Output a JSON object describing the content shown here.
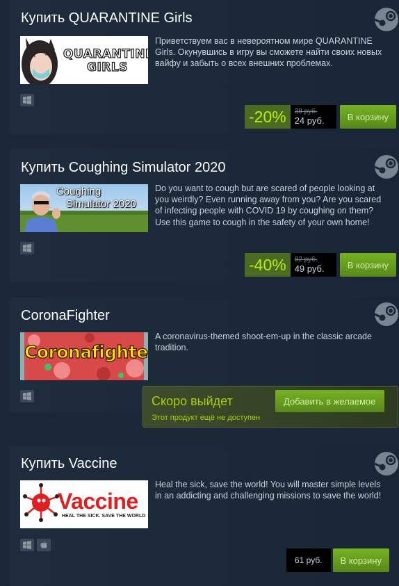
{
  "cards": [
    {
      "title": "Купить QUARANTINE Girls",
      "thumb_text_1": "QUARANTINE",
      "thumb_text_2": "GIRLS",
      "description": "Приветствуем вас в невероятном мире QUARANTINE Girls. Окунувшись в игру вы сможете найти своих новых вайфу и забыть о всех внешних проблемах.",
      "discount": "-20%",
      "old_price": "38 руб.",
      "new_price": "24 руб.",
      "cart_label": "В корзину"
    },
    {
      "title": "Купить Coughing Simulator 2020",
      "thumb_text_1": "Coughing",
      "thumb_text_2": "Simulator 2020",
      "description": "Do you want to cough but are scared of people looking at you weirdly? Even running away from you? Are you scared of infecting people with COVID 19 by coughing on them? Use this game to cough in the safety of your own home!",
      "discount": "-40%",
      "old_price": "82 руб.",
      "new_price": "49 руб.",
      "cart_label": "В корзину"
    },
    {
      "title": "CoronaFighter",
      "thumb_text_1": "Coronafighter",
      "description": "A coronavirus-themed shoot-em-up in the classic arcade tradition.",
      "coming_title": "Скоро выйдет",
      "coming_sub": "Этот продукт ещё не доступен",
      "wishlist_label": "Добавить в желаемое"
    },
    {
      "title": "Купить Vaccine",
      "thumb_text_1": "Vaccine",
      "thumb_text_2": "HEAL THE SICK. SAVE THE WORLD",
      "description": "Heal the sick, save the world! You will master simple levels in an addicting and challenging missions to save the world!",
      "price": "61 руб.",
      "cart_label": "В корзину"
    }
  ],
  "icons": {
    "steam": "steam-logo-icon",
    "windows": "windows-icon",
    "apple": "apple-icon"
  },
  "colors": {
    "background": "#1b2838",
    "discount_bg": "#4c6b22",
    "discount_text": "#beee11",
    "cart_button": "#75b022"
  }
}
